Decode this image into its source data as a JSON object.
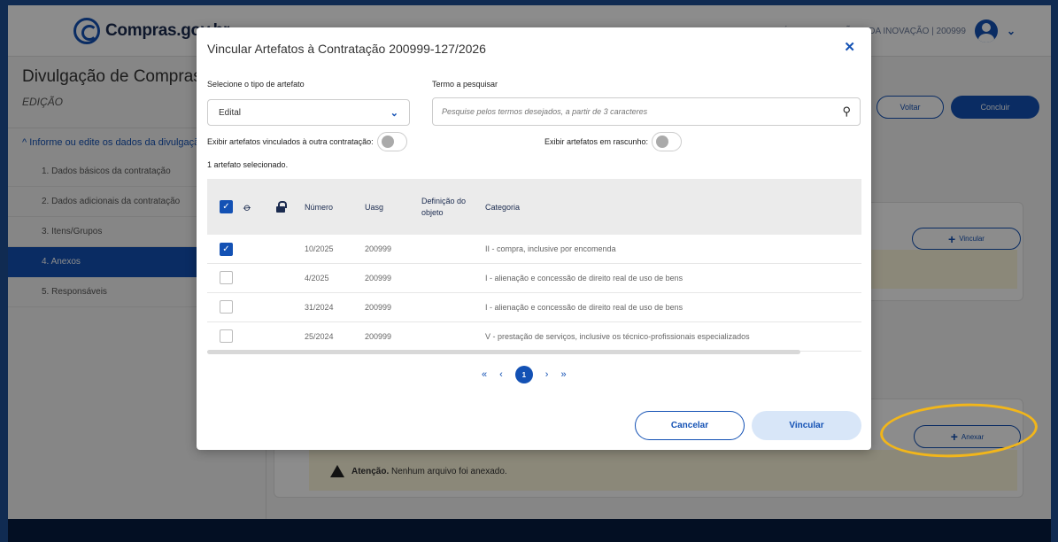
{
  "app": {
    "logo_text": "Compras.gov.br",
    "user_text": "MINISTÉRIO DA GESTÃO E DA INOVAÇÃO | 200999"
  },
  "page": {
    "title": "Divulgação de Compras",
    "subtitle": "EDIÇÃO",
    "voltar_label": "Voltar",
    "concluir_label": "Concluir",
    "vincular_label": "Vincular",
    "anexar_label": "Anexar",
    "warning_bold": "Atenção.",
    "warning_text": "Nenhum arquivo foi anexado."
  },
  "sidebar": {
    "header": "Informe ou edite os dados da divulgação",
    "items": [
      {
        "label": "1. Dados básicos da contratação",
        "active": false
      },
      {
        "label": "2. Dados adicionais da contratação",
        "active": false
      },
      {
        "label": "3. Itens/Grupos",
        "active": false
      },
      {
        "label": "4. Anexos",
        "active": true
      },
      {
        "label": "5. Responsáveis",
        "active": false
      }
    ]
  },
  "modal": {
    "title": "Vincular Artefatos à Contratação 200999-127/2026",
    "type_label": "Selecione o tipo de artefato",
    "type_value": "Edital",
    "search_label": "Termo a pesquisar",
    "search_placeholder": "Pesquise pelos termos desejados, a partir de 3 caracteres",
    "toggle_other_label": "Exibir artefatos vinculados à outra contratação:",
    "toggle_draft_label": "Exibir artefatos em rascunho:",
    "selected_count": "1 artefato selecionado.",
    "columns": {
      "numero": "Número",
      "uasg": "Uasg",
      "definicao": "Definição do objeto",
      "categoria": "Categoria"
    },
    "rows": [
      {
        "checked": true,
        "numero": "10/2025",
        "uasg": "200999",
        "definicao": "",
        "categoria": "II - compra, inclusive por encomenda"
      },
      {
        "checked": false,
        "numero": "4/2025",
        "uasg": "200999",
        "definicao": "",
        "categoria": "I - alienação e concessão de direito real de uso de bens"
      },
      {
        "checked": false,
        "numero": "31/2024",
        "uasg": "200999",
        "definicao": "",
        "categoria": "I - alienação e concessão de direito real de uso de bens"
      },
      {
        "checked": false,
        "numero": "25/2024",
        "uasg": "200999",
        "definicao": "",
        "categoria": "V - prestação de serviços, inclusive os técnico-profissionais especializados"
      }
    ],
    "pagination": {
      "first": "«",
      "prev": "‹",
      "current": "1",
      "next": "›",
      "last": "»"
    },
    "cancel_label": "Cancelar",
    "confirm_label": "Vincular"
  },
  "colors": {
    "primary": "#1351b4",
    "highlight_circle": "#f2b61a",
    "outer_border": "#1e4f96"
  }
}
